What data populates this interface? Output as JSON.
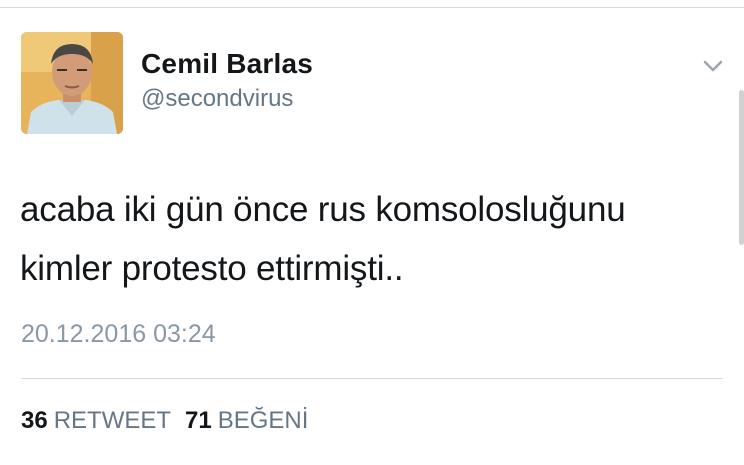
{
  "author": {
    "display_name": "Cemil Barlas",
    "handle": "@secondvirus"
  },
  "tweet": {
    "lines": [
      "acaba iki gün önce rus komsolosluğunu",
      "kimler protesto ettirmişti.."
    ],
    "timestamp": "20.12.2016 03:24"
  },
  "stats": {
    "retweets_count": "36",
    "retweets_label": "RETWEET",
    "likes_count": "71",
    "likes_label": "BEĞENİ"
  },
  "icons": {
    "menu": "chevron-down-icon"
  },
  "colors": {
    "text": "#14171a",
    "secondary": "#657786",
    "muted": "#8899a6",
    "divider": "#d7dadd"
  }
}
